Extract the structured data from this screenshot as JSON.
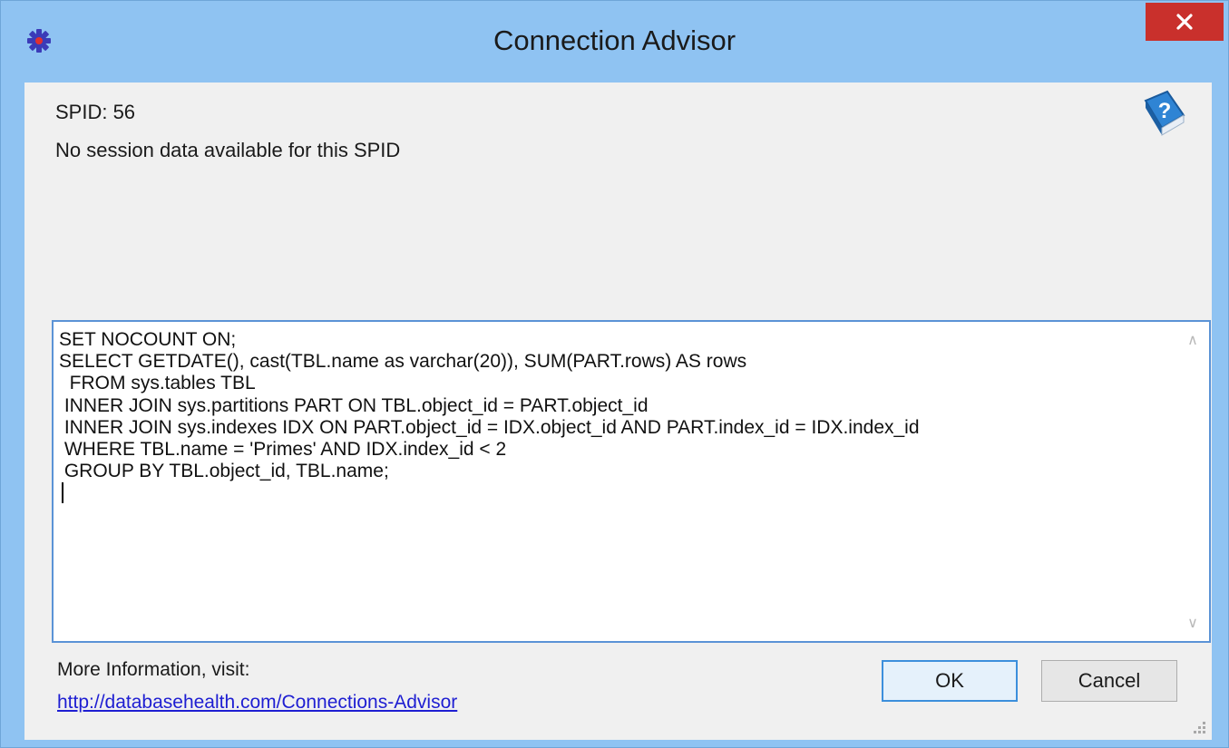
{
  "window": {
    "title": "Connection Advisor",
    "close_symbol": "✕",
    "app_icon": "database-gear-icon",
    "help_icon": "help-book-icon"
  },
  "info": {
    "spid": "SPID: 56",
    "session_message": "No session data available for this SPID"
  },
  "sql": {
    "lines": [
      "SET NOCOUNT ON;",
      "SELECT GETDATE(), cast(TBL.name as varchar(20)), SUM(PART.rows) AS rows",
      "  FROM sys.tables TBL",
      " INNER JOIN sys.partitions PART ON TBL.object_id = PART.object_id",
      " INNER JOIN sys.indexes IDX ON PART.object_id = IDX.object_id AND PART.index_id = IDX.index_id",
      " WHERE TBL.name = 'Primes' AND IDX.index_id < 2",
      " GROUP BY TBL.object_id, TBL.name;"
    ]
  },
  "scrollbar": {
    "up_symbol": "∧",
    "down_symbol": "∨"
  },
  "footer": {
    "more_info_label": "More Information, visit:",
    "link_text": "http://databasehealth.com/Connections-Advisor"
  },
  "buttons": {
    "ok": "OK",
    "cancel": "Cancel"
  },
  "colors": {
    "title_bar": "#8fc3f2",
    "close_button": "#c9302c",
    "client_background": "#f0f0f0",
    "editor_border": "#5b93d6",
    "link": "#1e1ed2"
  }
}
